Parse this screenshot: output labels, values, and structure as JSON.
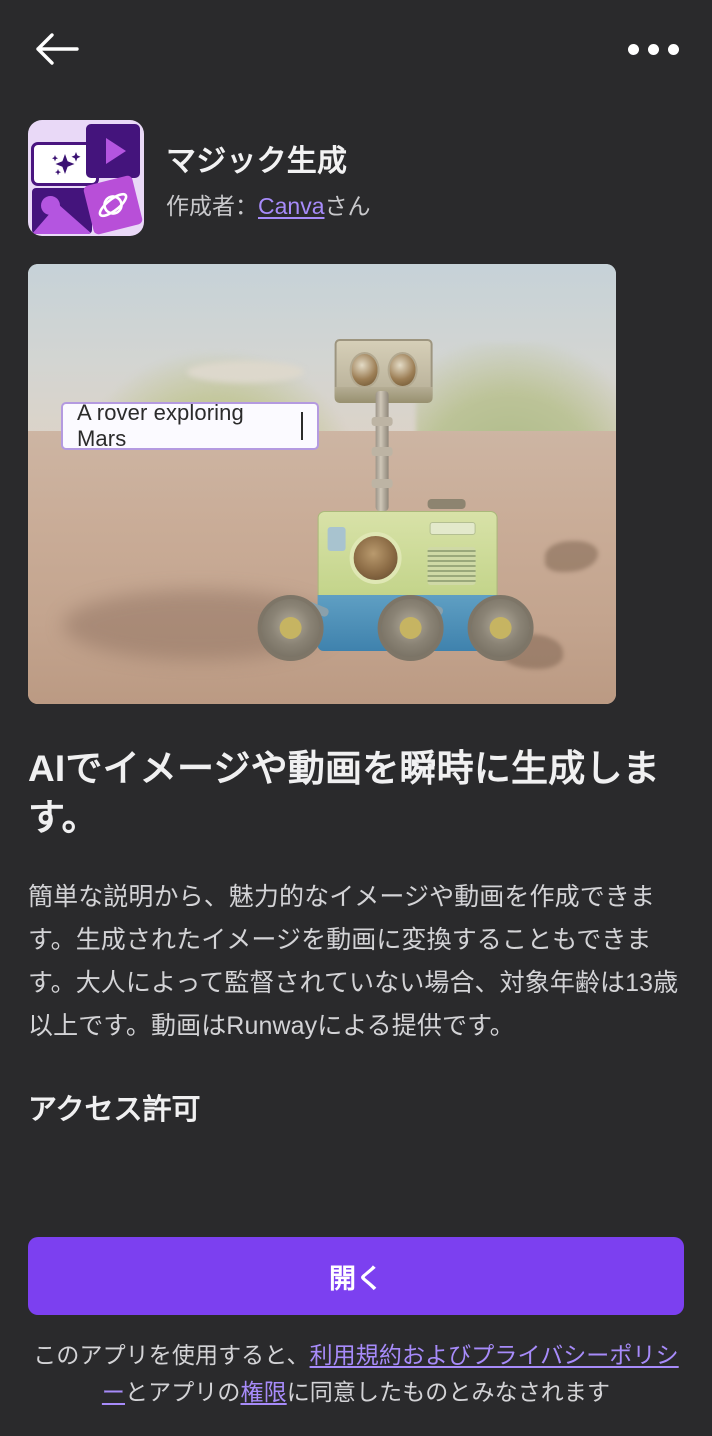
{
  "header": {
    "back_icon": "arrow-left-icon",
    "more_icon": "overflow-menu-icon"
  },
  "app": {
    "icon_name": "magic-media-app-icon",
    "title": "マジック生成",
    "author_prefix": "作成者：",
    "author_link": "Canva",
    "author_suffix": "さん"
  },
  "hero": {
    "image_name": "mars-rover-preview",
    "prompt_value": "A rover exploring Mars"
  },
  "main": {
    "headline": "AIでイメージや動画を瞬時に生成します。",
    "description": "簡単な説明から、魅力的なイメージや動画を作成できます。生成されたイメージを動画に変換することもできます。大人によって監督されていない場合、対象年齢は13歳以上です。動画はRunwayによる提供です。",
    "permissions_title": "アクセス許可"
  },
  "footer": {
    "cta_label": "開く",
    "legal_prefix": "このアプリを使用すると、",
    "legal_link_terms": "利用規約およびプライバシーポリシー",
    "legal_middle": "とアプリの",
    "legal_link_permissions": "権限",
    "legal_suffix": "に同意したものとみなされます"
  },
  "colors": {
    "background": "#2a2a2c",
    "accent": "#7c40f0",
    "link": "#a78bfa",
    "text_primary": "#f0f0f1",
    "text_secondary": "#d3d3d6"
  }
}
